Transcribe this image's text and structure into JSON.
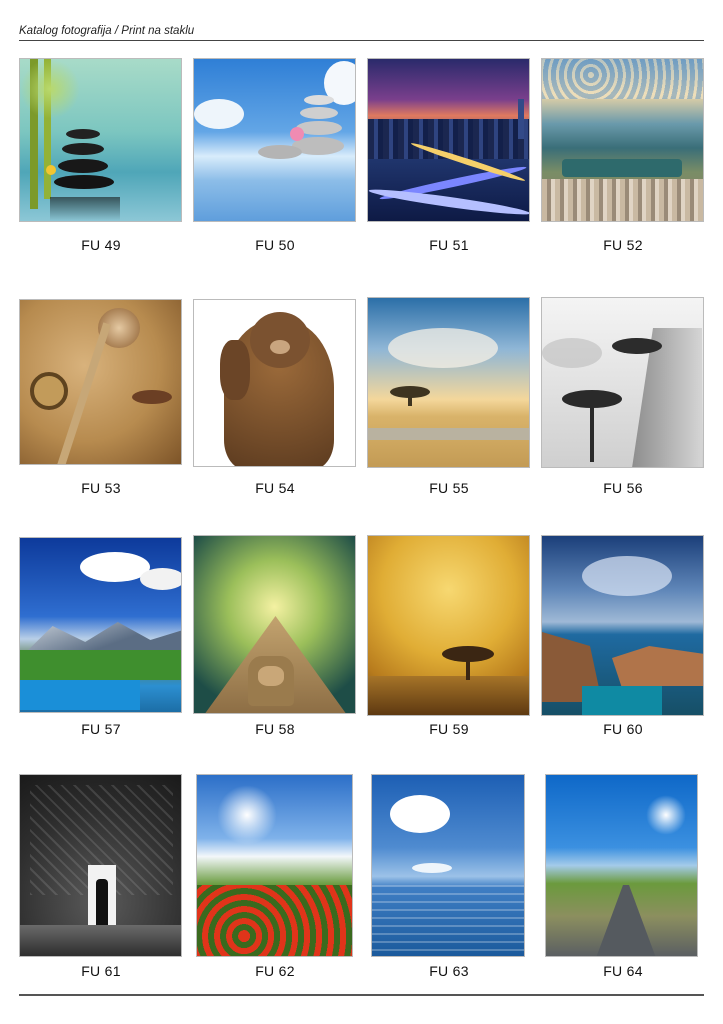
{
  "header": {
    "title": "Katalog fotografija / Print na staklu"
  },
  "items": [
    {
      "code": "FU 49"
    },
    {
      "code": "FU 50"
    },
    {
      "code": "FU 51"
    },
    {
      "code": "FU 52"
    },
    {
      "code": "FU 53"
    },
    {
      "code": "FU 54"
    },
    {
      "code": "FU 55"
    },
    {
      "code": "FU 56"
    },
    {
      "code": "FU 57"
    },
    {
      "code": "FU 58"
    },
    {
      "code": "FU 59"
    },
    {
      "code": "FU 60"
    },
    {
      "code": "FU 61"
    },
    {
      "code": "FU 62"
    },
    {
      "code": "FU 63"
    },
    {
      "code": "FU 64"
    }
  ]
}
